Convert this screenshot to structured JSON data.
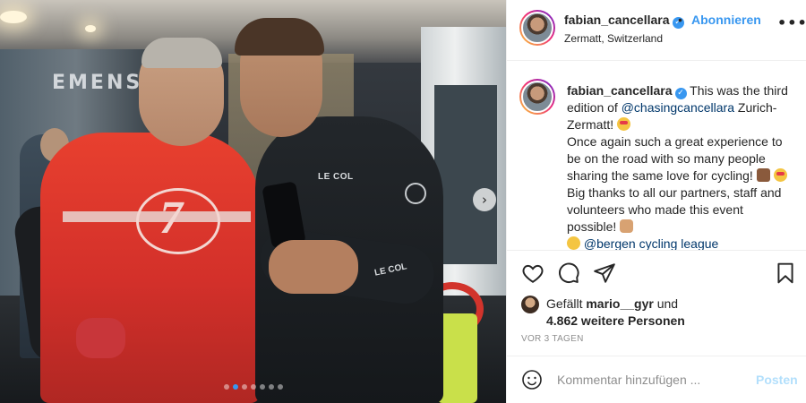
{
  "post": {
    "username": "fabian_cancellara",
    "follow_label": "Abonnieren",
    "bullet": "•",
    "location": "Zermatt, Switzerland",
    "more_icon": "more-options-icon",
    "more_label": "•••"
  },
  "photo": {
    "sign_text": "EMENS",
    "brand_small": "LE COL",
    "brand_arm": "LE COL",
    "next_icon": "chevron-right-icon",
    "next_label": "›",
    "slide_count": 7,
    "active_slide": 1
  },
  "caption": {
    "username": "fabian_cancellara",
    "part1": " This was the third edition of ",
    "mention": "@chasingcancellara",
    "part2": " Zurich-Zermatt! ",
    "part3": "Once again such a great experience to be on the road with so many people sharing the same love for cycling! ",
    "part4": "Big thanks to all our partners, staff and volunteers who made this event possible! ",
    "part5": "@bergen cycling league",
    "emojis": [
      "heart-eyes-emoji",
      "couple-emoji",
      "heart-eyes-emoji",
      "flexed-biceps-emoji"
    ]
  },
  "actions": {
    "like_icon": "heart-icon",
    "comment_icon": "comment-icon",
    "share_icon": "share-icon",
    "save_icon": "bookmark-icon"
  },
  "likes": {
    "prefix": "Gefällt ",
    "user": "mario__gyr",
    "mid": " und ",
    "count_text": "4.862 weitere Personen"
  },
  "timestamp": "VOR 3 TAGEN",
  "comment": {
    "placeholder": "Kommentar hinzufügen ...",
    "post_label": "Posten",
    "emoji_icon": "smiley-icon"
  },
  "colors": {
    "link_blue": "#3897f0",
    "mention_blue": "#00376b",
    "post_disabled": "#b2dffc",
    "muted": "#8e8e8e"
  }
}
